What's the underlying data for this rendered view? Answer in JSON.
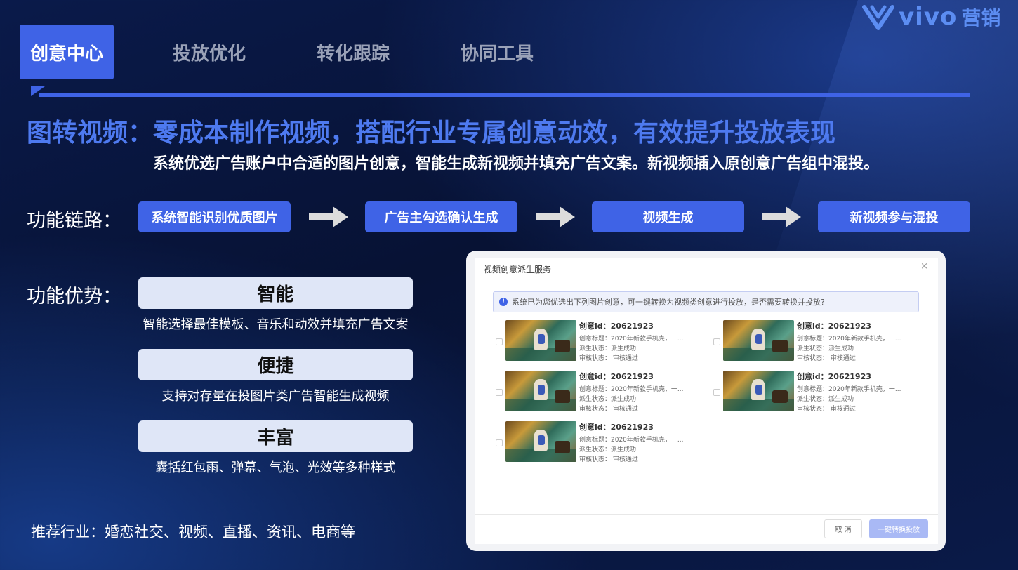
{
  "brand": {
    "name": "vivo",
    "suffix": "营销"
  },
  "tabs": [
    {
      "label": "创意中心",
      "active": true
    },
    {
      "label": "投放优化",
      "active": false
    },
    {
      "label": "转化跟踪",
      "active": false
    },
    {
      "label": "协同工具",
      "active": false
    }
  ],
  "headline": "图转视频：零成本制作视频，搭配行业专属创意动效，有效提升投放表现",
  "subline": "系统优选广告账户中合适的图片创意，智能生成新视频并填充广告文案。新视频插入原创意广告组中混投。",
  "flow": {
    "label": "功能链路：",
    "steps": [
      "系统智能识别优质图片",
      "广告主勾选确认生成",
      "视频生成",
      "新视频参与混投"
    ]
  },
  "advantages": {
    "label": "功能优势：",
    "items": [
      {
        "title": "智能",
        "desc": "智能选择最佳模板、音乐和动效并填充广告文案"
      },
      {
        "title": "便捷",
        "desc": "支持对存量在投图片类广告智能生成视频"
      },
      {
        "title": "丰富",
        "desc": "囊括红包雨、弹幕、气泡、光效等多种样式"
      }
    ]
  },
  "industry": "推荐行业：婚恋社交、视频、直播、资讯、电商等",
  "dialog": {
    "title": "视频创意派生服务",
    "close": "×",
    "notice": "系统已为您优选出下列图片创意，可一键转换为视频类创意进行投放，是否需要转换并投放?",
    "items": [
      {
        "id": "创意id：20621923",
        "title": "创意标题：2020年新款手机壳，一...",
        "derive": "派生状态：派生成功",
        "review": "审核状态：  审核通过"
      },
      {
        "id": "创意id：20621923",
        "title": "创意标题：2020年新款手机壳，一...",
        "derive": "派生状态：派生成功",
        "review": "审核状态：  审核通过"
      },
      {
        "id": "创意id：20621923",
        "title": "创意标题：2020年新款手机壳，一...",
        "derive": "派生状态：派生成功",
        "review": "审核状态：  审核通过"
      },
      {
        "id": "创意id：20621923",
        "title": "创意标题：2020年新款手机壳，一...",
        "derive": "派生状态：派生成功",
        "review": "审核状态：  审核通过"
      },
      {
        "id": "创意id：20621923",
        "title": "创意标题：2020年新款手机壳，一...",
        "derive": "派生状态：派生成功",
        "review": "审核状态：  审核通过"
      }
    ],
    "cancel": "取 消",
    "confirm": "一键转换投放"
  },
  "colors": {
    "accent": "#3f63e6",
    "headline": "#4e7af0",
    "card": "#dfe6f7"
  }
}
